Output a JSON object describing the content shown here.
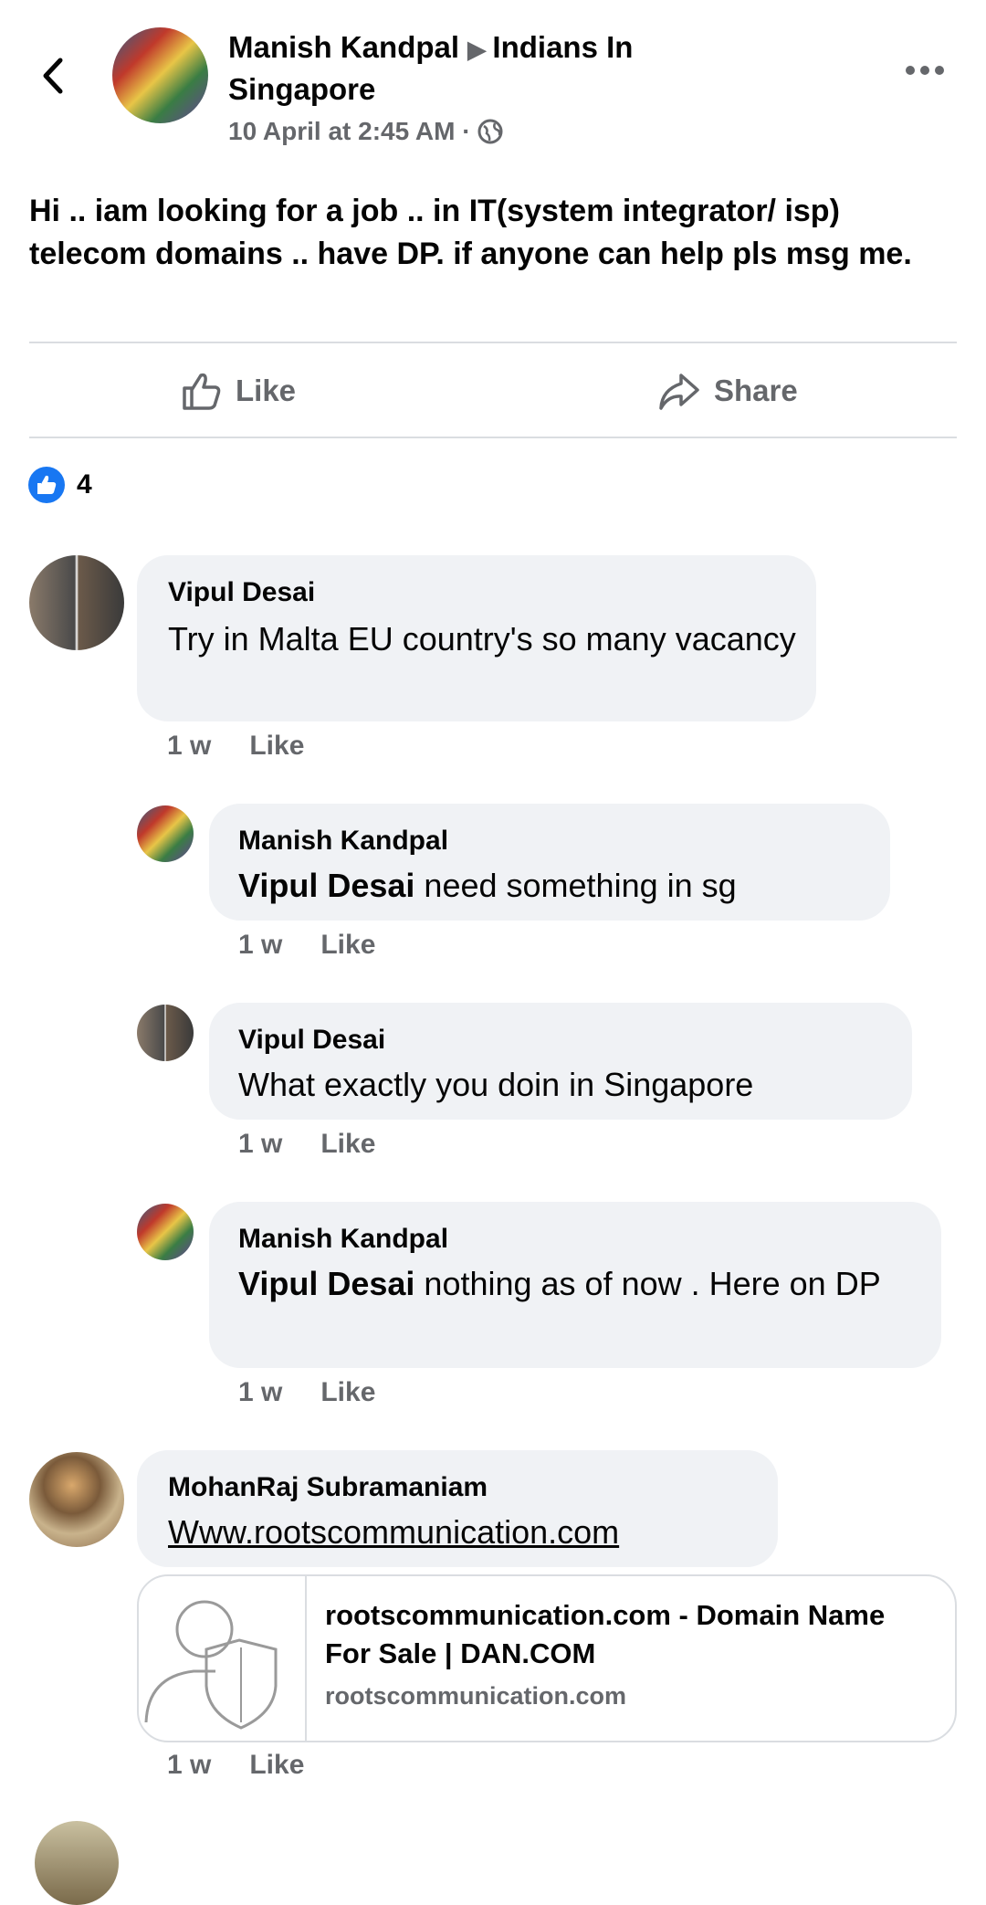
{
  "post": {
    "author": "Manish Kandpal",
    "group_line1": "Indians In",
    "group_line2": "Singapore",
    "timestamp": "10 April at 2:45 AM · ",
    "body": "Hi .. iam looking for a job .. in IT(system integrator/ isp) telecom domains .. have DP. if anyone can help pls msg me.",
    "like_label": "Like",
    "share_label": "Share",
    "reaction_count": "4"
  },
  "comments": [
    {
      "author": "Vipul Desai",
      "text": "Try in Malta EU country's so many vacancy",
      "time": "1 w",
      "like": "Like"
    },
    {
      "author": "Manish Kandpal",
      "mention": "Vipul Desai",
      "text": " need something in sg",
      "time": "1 w",
      "like": "Like"
    },
    {
      "author": "Vipul Desai",
      "text": "What exactly you doin in Singapore",
      "time": "1 w",
      "like": "Like"
    },
    {
      "author": "Manish Kandpal",
      "mention": "Vipul Desai",
      "text": " nothing as of now . Here on DP",
      "time": "1 w",
      "like": "Like"
    },
    {
      "author": "MohanRaj Subramaniam",
      "link": "Www.rootscommunication.com",
      "time": "1 w",
      "like": "Like"
    }
  ],
  "link_preview": {
    "title": "rootscommunication.com - Domain Name For Sale | DAN.COM",
    "domain": "rootscommunication.com"
  },
  "colors": {
    "bubble": "#f0f2f5",
    "meta_text": "#65676b",
    "like_blue": "#1877f2",
    "divider": "#dadde1"
  }
}
